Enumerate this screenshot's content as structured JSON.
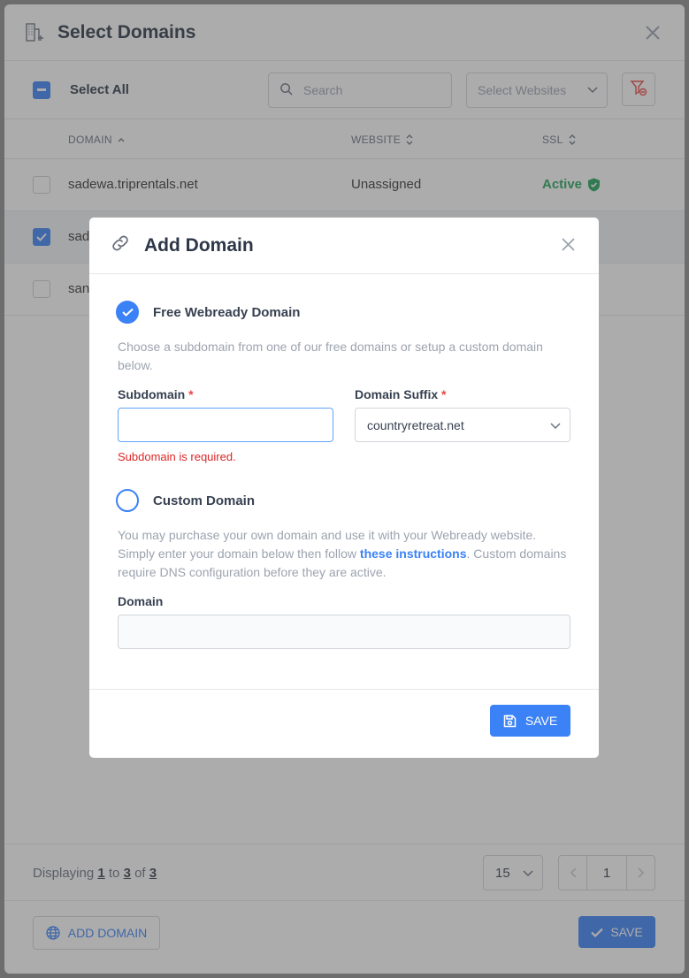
{
  "outer": {
    "title": "Select Domains",
    "select_all_label": "Select All",
    "search_placeholder": "Search",
    "select_websites_placeholder": "Select Websites",
    "columns": {
      "domain": "DOMAIN",
      "website": "WEBSITE",
      "ssl": "SSL"
    },
    "rows": [
      {
        "domain": "sadewa.triprentals.net",
        "website": "Unassigned",
        "ssl": "Active",
        "checked": false
      },
      {
        "domain": "sad",
        "website": "",
        "ssl": "",
        "checked": true
      },
      {
        "domain": "san",
        "website": "",
        "ssl": "",
        "checked": false
      }
    ],
    "pagination": {
      "displaying": "Displaying",
      "from": "1",
      "to_word": "to",
      "to": "3",
      "of_word": "of",
      "total": "3",
      "per_page": "15",
      "current_page": "1"
    },
    "add_domain_label": "ADD DOMAIN",
    "save_label": "SAVE"
  },
  "modal": {
    "title": "Add Domain",
    "free_option_label": "Free Webready Domain",
    "free_help": "Choose a subdomain from one of our free domains or setup a custom domain below.",
    "subdomain_label": "Subdomain",
    "required_mark": "*",
    "subdomain_value": "",
    "suffix_label": "Domain Suffix",
    "suffix_value": "countryretreat.net",
    "subdomain_error": "Subdomain is required.",
    "custom_option_label": "Custom Domain",
    "custom_help_before": "You may purchase your own domain and use it with your Webready website. Simply enter your domain below then follow ",
    "custom_help_link": "these instructions",
    "custom_help_after": ". Custom domains require DNS configuration before they are active.",
    "domain_label": "Domain",
    "domain_value": "",
    "save_label": "SAVE"
  },
  "colors": {
    "accent": "#3b82f6",
    "success": "#22a55a",
    "error": "#dc2626"
  }
}
